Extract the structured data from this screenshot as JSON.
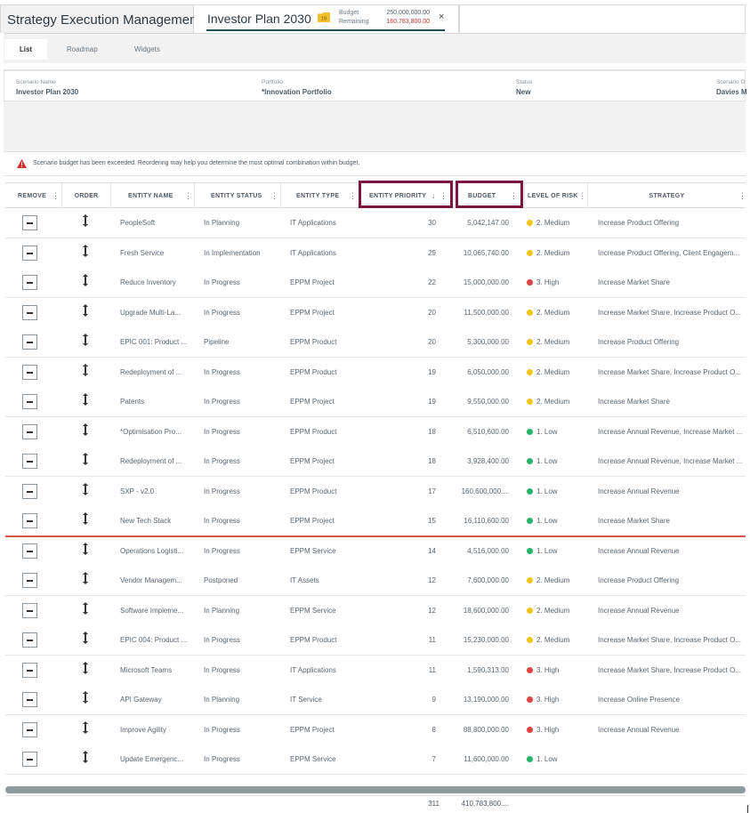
{
  "app": {
    "title": "Strategy Execution Management"
  },
  "plan_tab": {
    "title": "Investor Plan 2030",
    "folder_badge": "19",
    "budget_label": "Budget",
    "budget_value": "250,000,000.00",
    "remaining_label": "Remaining",
    "remaining_value": "160,783,800.00",
    "close_glyph": "×"
  },
  "subtabs": [
    {
      "label": "List"
    },
    {
      "label": "Roadmap"
    },
    {
      "label": "Widgets"
    }
  ],
  "info": {
    "scenario_name_label": "Scenario Name",
    "scenario_name_value": "Investor Plan 2030",
    "portfolio_label": "Portfolio",
    "portfolio_value": "*Innovation Portfolio",
    "status_label": "Status",
    "status_value": "New",
    "owner_label": "Scenario O",
    "owner_value": "Davies M"
  },
  "warning": {
    "text": "Scenario budget has been exceeded. Reordering may help you determine the most optimal combination within budget."
  },
  "colors": {
    "accent": "#1d4e5c",
    "highlight_border": "#7a1640",
    "remaining_red": "#d0332b",
    "risk_medium": "#f0c419",
    "risk_high": "#e04440",
    "risk_low": "#27b36a"
  },
  "columns": [
    {
      "label": "REMOVE"
    },
    {
      "label": "ORDER"
    },
    {
      "label": "ENTITY NAME"
    },
    {
      "label": "ENTITY STATUS"
    },
    {
      "label": "ENTITY TYPE"
    },
    {
      "label": "ENTITY PRIORITY"
    },
    {
      "label": "BUDGET"
    },
    {
      "label": "LEVEL OF RISK"
    },
    {
      "label": "STRATEGY"
    }
  ],
  "sort_icon": "↓",
  "menu_icon": "⋮",
  "rows": [
    {
      "name": "PeopleSoft",
      "status": "In Planning",
      "type": "IT Applications",
      "priority": "30",
      "budget": "5,042,147.00",
      "risk": "2. Medium",
      "risk_level": "medium",
      "strategy": "Increase Product Offering"
    },
    {
      "name": "Fresh Service",
      "status": "In Implementation",
      "type": "IT Applications",
      "priority": "29",
      "budget": "10,065,740.00",
      "risk": "2. Medium",
      "risk_level": "medium",
      "strategy": "Increase Product Offering, Client Engagem..."
    },
    {
      "name": "Reduce Inventory",
      "status": "In Progress",
      "type": "EPPM Project",
      "priority": "22",
      "budget": "15,000,000.00",
      "risk": "3. High",
      "risk_level": "high",
      "strategy": "Increase Market Share"
    },
    {
      "name": "Upgrade Multi-La...",
      "status": "In Progress",
      "type": "EPPM Project",
      "priority": "20",
      "budget": "11,500,000.00",
      "risk": "2. Medium",
      "risk_level": "medium",
      "strategy": "Increase Market Share, Increase Product O..."
    },
    {
      "name": "EPIC 001: Product ...",
      "status": "Pipeline",
      "type": "EPPM Product",
      "priority": "20",
      "budget": "5,300,000.00",
      "risk": "2. Medium",
      "risk_level": "medium",
      "strategy": "Increase Product Offering"
    },
    {
      "name": "Redeployment of ...",
      "status": "In Progress",
      "type": "EPPM Product",
      "priority": "19",
      "budget": "6,050,000.00",
      "risk": "2. Medium",
      "risk_level": "medium",
      "strategy": "Increase Market Share, Increase Product O..."
    },
    {
      "name": "Patents",
      "status": "In Progress",
      "type": "EPPM Project",
      "priority": "19",
      "budget": "9,550,000.00",
      "risk": "2. Medium",
      "risk_level": "medium",
      "strategy": "Increase Market Share"
    },
    {
      "name": "*Optimisation Pro...",
      "status": "In Progress",
      "type": "EPPM Product",
      "priority": "18",
      "budget": "6,510,600.00",
      "risk": "1. Low",
      "risk_level": "low",
      "strategy": "Increase Annual Revenue, Increase Market ..."
    },
    {
      "name": "Redeployment of ...",
      "status": "In Progress",
      "type": "EPPM Project",
      "priority": "18",
      "budget": "3,928,400.00",
      "risk": "1. Low",
      "risk_level": "low",
      "strategy": "Increase Annual Revenue, Increase Market ..."
    },
    {
      "name": "SXP - v2.0",
      "status": "In Progress",
      "type": "EPPM Product",
      "priority": "17",
      "budget": "160,600,000....",
      "risk": "1. Low",
      "risk_level": "low",
      "strategy": "Increase Annual Revenue"
    },
    {
      "name": "New Tech Stack",
      "status": "In Progress",
      "type": "EPPM Project",
      "priority": "15",
      "budget": "16,110,600.00",
      "risk": "1. Low",
      "risk_level": "low",
      "strategy": "Increase Market Share"
    },
    {
      "name": "Operations Logisti...",
      "status": "In Progress",
      "type": "EPPM Service",
      "priority": "14",
      "budget": "4,516,000.00",
      "risk": "1. Low",
      "risk_level": "low",
      "strategy": "Increase Annual Revenue"
    },
    {
      "name": "Vendor Managem...",
      "status": "Postponed",
      "type": "IT Assets",
      "priority": "12",
      "budget": "7,600,000.00",
      "risk": "2. Medium",
      "risk_level": "medium",
      "strategy": "Increase Product Offering"
    },
    {
      "name": "Software Impleme...",
      "status": "In Planning",
      "type": "EPPM Service",
      "priority": "12",
      "budget": "18,600,000.00",
      "risk": "2. Medium",
      "risk_level": "medium",
      "strategy": "Increase Annual Revenue"
    },
    {
      "name": "EPIC 004: Product ...",
      "status": "In Progress",
      "type": "EPPM Product",
      "priority": "11",
      "budget": "15,230,000.00",
      "risk": "2. Medium",
      "risk_level": "medium",
      "strategy": "Increase Market Share, Increase Product O..."
    },
    {
      "name": "Microsoft Teams",
      "status": "In Progress",
      "type": "IT Applications",
      "priority": "11",
      "budget": "1,590,313.00",
      "risk": "3. High",
      "risk_level": "high",
      "strategy": "Increase Market Share, Increase Product O..."
    },
    {
      "name": "API Gateway",
      "status": "In Planning",
      "type": "IT Service",
      "priority": "9",
      "budget": "13,190,000.00",
      "risk": "3. High",
      "risk_level": "high",
      "strategy": "Increase Online Presence"
    },
    {
      "name": "Improve Agility",
      "status": "In Progress",
      "type": "EPPM Project",
      "priority": "8",
      "budget": "88,800,000.00",
      "risk": "3. High",
      "risk_level": "high",
      "strategy": "Increase Annual Revenue"
    },
    {
      "name": "Update Emergenc...",
      "status": "In Progress",
      "type": "EPPM Service",
      "priority": "7",
      "budget": "11,600,000.00",
      "risk": "1. Low",
      "risk_level": "low",
      "strategy": ""
    }
  ],
  "totals": {
    "priority": "311",
    "budget": "410,783,800...."
  }
}
